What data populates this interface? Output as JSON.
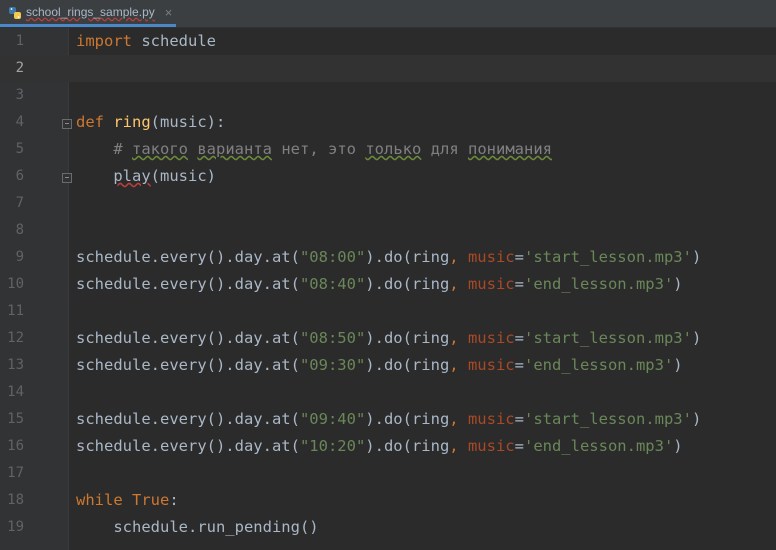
{
  "tab": {
    "filename": "school_rings_sample.py",
    "close_glyph": "×",
    "icon": "python-file-icon"
  },
  "editor": {
    "current_line": 2,
    "lines": [
      {
        "n": "1",
        "tokens": [
          {
            "t": "import",
            "c": "kw"
          },
          {
            "t": " schedule",
            "c": ""
          }
        ]
      },
      {
        "n": "2",
        "tokens": []
      },
      {
        "n": "3",
        "tokens": []
      },
      {
        "n": "4",
        "tokens": [
          {
            "t": "def",
            "c": "kw"
          },
          {
            "t": " ",
            "c": ""
          },
          {
            "t": "ring",
            "c": "fn"
          },
          {
            "t": "(music):",
            "c": ""
          }
        ]
      },
      {
        "n": "5",
        "tokens": [
          {
            "t": "    ",
            "c": ""
          },
          {
            "t": "# ",
            "c": "cmt"
          },
          {
            "t": "такого",
            "c": "cmt warn"
          },
          {
            "t": " ",
            "c": "cmt"
          },
          {
            "t": "варианта",
            "c": "cmt warn"
          },
          {
            "t": " нет, это ",
            "c": "cmt"
          },
          {
            "t": "только",
            "c": "cmt warn"
          },
          {
            "t": " для ",
            "c": "cmt"
          },
          {
            "t": "понимания",
            "c": "cmt warn"
          }
        ]
      },
      {
        "n": "6",
        "tokens": [
          {
            "t": "    ",
            "c": ""
          },
          {
            "t": "play",
            "c": "err"
          },
          {
            "t": "(music)",
            "c": ""
          }
        ]
      },
      {
        "n": "7",
        "tokens": []
      },
      {
        "n": "8",
        "tokens": []
      },
      {
        "n": "9",
        "tokens": [
          {
            "t": "schedule.every().day.at(",
            "c": ""
          },
          {
            "t": "\"08:00\"",
            "c": "str"
          },
          {
            "t": ").do(ring",
            "c": ""
          },
          {
            "t": ", ",
            "c": "kw"
          },
          {
            "t": "music",
            "c": "param"
          },
          {
            "t": "=",
            "c": ""
          },
          {
            "t": "'start_lesson.mp3'",
            "c": "str"
          },
          {
            "t": ")",
            "c": ""
          }
        ]
      },
      {
        "n": "10",
        "tokens": [
          {
            "t": "schedule.every().day.at(",
            "c": ""
          },
          {
            "t": "\"08:40\"",
            "c": "str"
          },
          {
            "t": ").do(ring",
            "c": ""
          },
          {
            "t": ", ",
            "c": "kw"
          },
          {
            "t": "music",
            "c": "param"
          },
          {
            "t": "=",
            "c": ""
          },
          {
            "t": "'end_lesson.mp3'",
            "c": "str"
          },
          {
            "t": ")",
            "c": ""
          }
        ]
      },
      {
        "n": "11",
        "tokens": []
      },
      {
        "n": "12",
        "tokens": [
          {
            "t": "schedule.every().day.at(",
            "c": ""
          },
          {
            "t": "\"08:50\"",
            "c": "str"
          },
          {
            "t": ").do(ring",
            "c": ""
          },
          {
            "t": ", ",
            "c": "kw"
          },
          {
            "t": "music",
            "c": "param"
          },
          {
            "t": "=",
            "c": ""
          },
          {
            "t": "'start_lesson.mp3'",
            "c": "str"
          },
          {
            "t": ")",
            "c": ""
          }
        ]
      },
      {
        "n": "13",
        "tokens": [
          {
            "t": "schedule.every().day.at(",
            "c": ""
          },
          {
            "t": "\"09:30\"",
            "c": "str"
          },
          {
            "t": ").do(ring",
            "c": ""
          },
          {
            "t": ", ",
            "c": "kw"
          },
          {
            "t": "music",
            "c": "param"
          },
          {
            "t": "=",
            "c": ""
          },
          {
            "t": "'end_lesson.mp3'",
            "c": "str"
          },
          {
            "t": ")",
            "c": ""
          }
        ]
      },
      {
        "n": "14",
        "tokens": []
      },
      {
        "n": "15",
        "tokens": [
          {
            "t": "schedule.every().day.at(",
            "c": ""
          },
          {
            "t": "\"09:40\"",
            "c": "str"
          },
          {
            "t": ").do(ring",
            "c": ""
          },
          {
            "t": ", ",
            "c": "kw"
          },
          {
            "t": "music",
            "c": "param"
          },
          {
            "t": "=",
            "c": ""
          },
          {
            "t": "'start_lesson.mp3'",
            "c": "str"
          },
          {
            "t": ")",
            "c": ""
          }
        ]
      },
      {
        "n": "16",
        "tokens": [
          {
            "t": "schedule.every().day.at(",
            "c": ""
          },
          {
            "t": "\"10:20\"",
            "c": "str"
          },
          {
            "t": ").do(ring",
            "c": ""
          },
          {
            "t": ", ",
            "c": "kw"
          },
          {
            "t": "music",
            "c": "param"
          },
          {
            "t": "=",
            "c": ""
          },
          {
            "t": "'end_lesson.mp3'",
            "c": "str"
          },
          {
            "t": ")",
            "c": ""
          }
        ]
      },
      {
        "n": "17",
        "tokens": []
      },
      {
        "n": "18",
        "tokens": [
          {
            "t": "while",
            "c": "kw"
          },
          {
            "t": " ",
            "c": ""
          },
          {
            "t": "True",
            "c": "kw"
          },
          {
            "t": ":",
            "c": ""
          }
        ]
      },
      {
        "n": "19",
        "tokens": [
          {
            "t": "    schedule.run_pending()",
            "c": ""
          }
        ]
      }
    ]
  }
}
